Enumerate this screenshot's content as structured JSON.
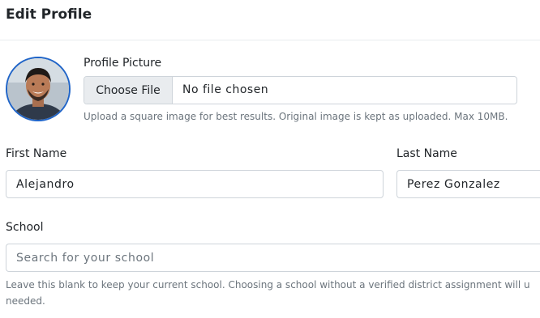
{
  "header": {
    "title": "Edit Profile"
  },
  "profile_picture": {
    "label": "Profile Picture",
    "choose_button": "Choose File",
    "status": "No file chosen",
    "help": "Upload a square image for best results. Original image is kept as uploaded. Max 10MB."
  },
  "first_name": {
    "label": "First Name",
    "value": "Alejandro"
  },
  "last_name": {
    "label": "Last Name",
    "value": "Perez Gonzalez"
  },
  "school": {
    "label": "School",
    "placeholder": "Search for your school",
    "help_line1": "Leave this blank to keep your current school. Choosing a school without a verified district assignment will u",
    "help_line2": "needed."
  },
  "colors": {
    "avatar_border": "#1f64c8",
    "input_border": "#ced4da",
    "muted_text": "#6c757d"
  }
}
